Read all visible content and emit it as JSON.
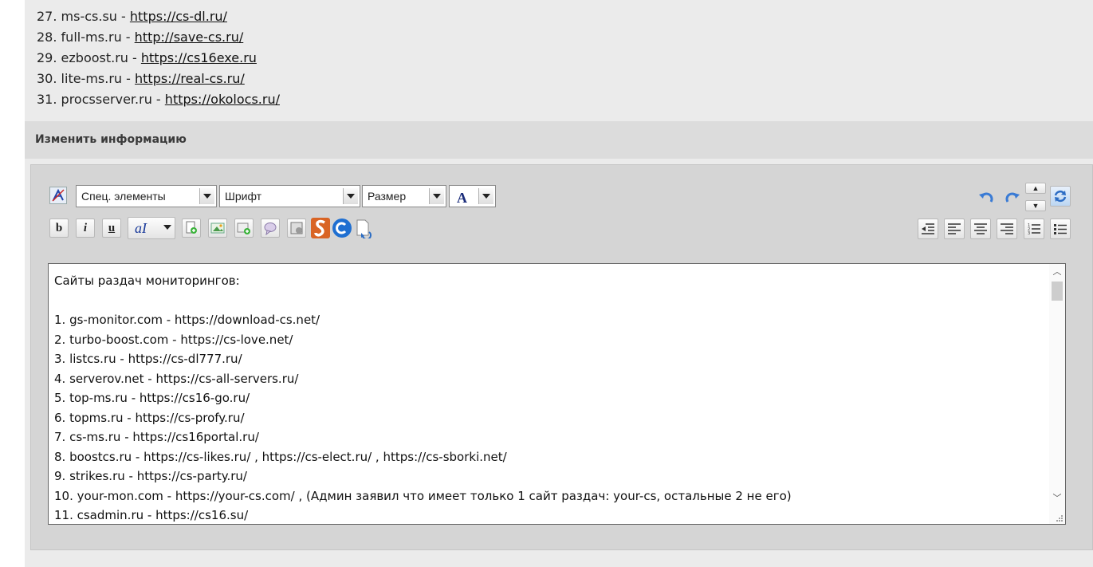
{
  "top_links": [
    {
      "num": "27.",
      "site": "ms-cs.su",
      "url": "https://cs-dl.ru/"
    },
    {
      "num": "28.",
      "site": "full-ms.ru",
      "url": "http://save-cs.ru/"
    },
    {
      "num": "29.",
      "site": "ezboost.ru",
      "url": "https://cs16exe.ru"
    },
    {
      "num": "30.",
      "site": "lite-ms.ru",
      "url": "https://real-cs.ru/"
    },
    {
      "num": "31.",
      "site": "procsserver.ru",
      "url": "https://okolocs.ru/"
    }
  ],
  "section": {
    "title": "Изменить информацию"
  },
  "toolbar": {
    "special_elements": "Спец. элементы",
    "font": "Шрифт",
    "size": "Размер",
    "color_letter": "A",
    "bold": "b",
    "italic": "i",
    "underline": "u",
    "format_letter": "aI"
  },
  "editor": {
    "heading": "Сайты раздач мониторингов:",
    "lines": [
      "1. gs-monitor.com - https://download-cs.net/",
      "2. turbo-boost.com - https://cs-love.net/",
      "3. listcs.ru - https://cs-dl777.ru/",
      "4. serverov.net - https://cs-all-servers.ru/",
      "5. top-ms.ru - https://cs16-go.ru/",
      "6. topms.ru - https://cs-profy.ru/",
      "7. cs-ms.ru - https://cs16portal.ru/",
      "8. boostcs.ru - https://cs-likes.ru/ , https://cs-elect.ru/ , https://cs-sborki.net/",
      "9. strikes.ru - https://cs-party.ru/",
      "10. your-mon.com - https://your-cs.com/ , (Админ заявил что имеет только 1 сайт раздач: your-cs, остальные 2 не его)",
      "11. csadmin.ru - https://cs16.su/"
    ]
  },
  "colors": {
    "accent_blue": "#2b6cc4",
    "panel": "#d5d5d5",
    "background": "#ebebeb"
  }
}
